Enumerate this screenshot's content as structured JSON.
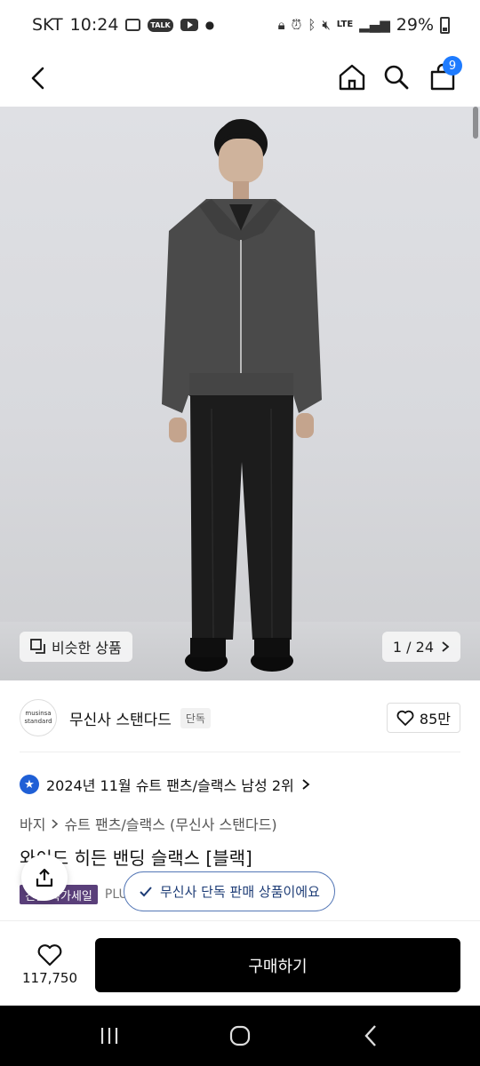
{
  "status_bar": {
    "carrier": "SKT",
    "time": "10:24",
    "network": "LTE",
    "battery": "29%"
  },
  "header": {
    "cart_count": "9"
  },
  "gallery": {
    "similar_label": "비슷한 상품",
    "counter": "1 / 24"
  },
  "brand": {
    "logo_line1": "musinsa",
    "logo_line2": "standard",
    "name": "무신사 스탠다드",
    "exclusive_tag": "단독",
    "likes": "85만"
  },
  "ranking": {
    "text": "2024년 11월 슈트 팬츠/슬랙스 남성 2위"
  },
  "breadcrumb": {
    "root": "바지",
    "sub": "슈트 팬츠/슬랙스 (무신사 스탠다드)"
  },
  "product": {
    "title": "와이드 히든 밴딩 슬랙스 [블랙]",
    "sale_tag": "긴급 특가세일",
    "plus_tag": "PLUS"
  },
  "toast": {
    "text": "무신사 단독 판매 상품이에요"
  },
  "buy_bar": {
    "wish_count": "117,750",
    "buy_label": "구매하기"
  },
  "colors": {
    "accent_blue": "#1e7bff",
    "rank_badge": "#1f5fd6",
    "sale_tag": "#5a3f7a",
    "toast_border": "#5477b6",
    "buy_button": "#000000"
  }
}
